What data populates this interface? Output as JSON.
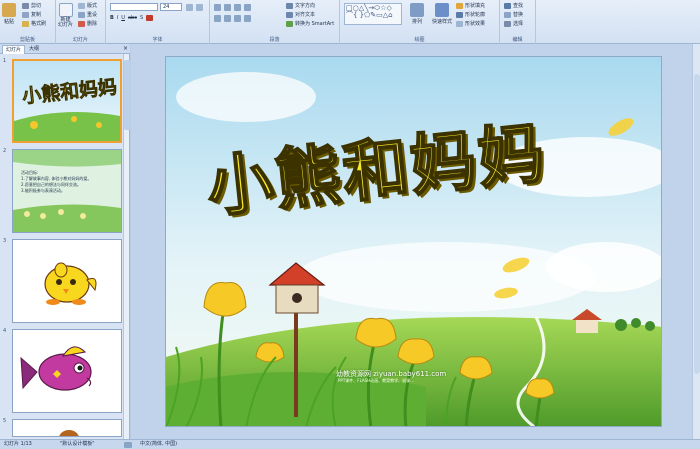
{
  "ribbon": {
    "clipboard": {
      "paste": "粘贴",
      "cut": "剪切",
      "copy": "复制",
      "format_painter": "格式刷",
      "label": "剪贴板"
    },
    "slides": {
      "new_slide": "新建\n幻灯片",
      "layout": "版式",
      "reset": "重设",
      "delete": "删除",
      "label": "幻灯片"
    },
    "font": {
      "family": "",
      "size": "24",
      "label": "字体"
    },
    "paragraph": {
      "text_direction": "文字方向",
      "align_text": "对齐文本",
      "smartart": "转换为 SmartArt",
      "label": "段落"
    },
    "drawing": {
      "arrange": "排列",
      "quick_styles": "快速样式",
      "shape_fill": "形状填充",
      "shape_outline": "形状轮廓",
      "shape_effects": "形状效果",
      "label": "绘图"
    },
    "editing": {
      "find": "查找",
      "replace": "替换",
      "select": "选择",
      "label": "编辑"
    }
  },
  "panel": {
    "tab_slides": "幻灯片",
    "tab_outline": "大纲",
    "thumbnails": [
      {
        "num": "1",
        "title": "小熊和妈妈"
      },
      {
        "num": "2",
        "lines": [
          "活动目标:",
          "1.了解故事内容, 体验小熊对妈妈的爱。",
          "2.愿意把自己的想法与同伴交流。",
          "3.能积极参与表演活动。"
        ]
      },
      {
        "num": "3"
      },
      {
        "num": "4"
      },
      {
        "num": "5"
      }
    ]
  },
  "slide": {
    "title": "小熊和妈妈",
    "watermark": "幼教资源网 ziyuan.baby611.com",
    "watermark_sub": "PPT课件、FLASH动画、教案教学、说课..."
  },
  "status": {
    "slide_pos": "幻灯片 1/13",
    "theme": "\"默认设计模板\"",
    "language": "中文(简体, 中国)"
  }
}
